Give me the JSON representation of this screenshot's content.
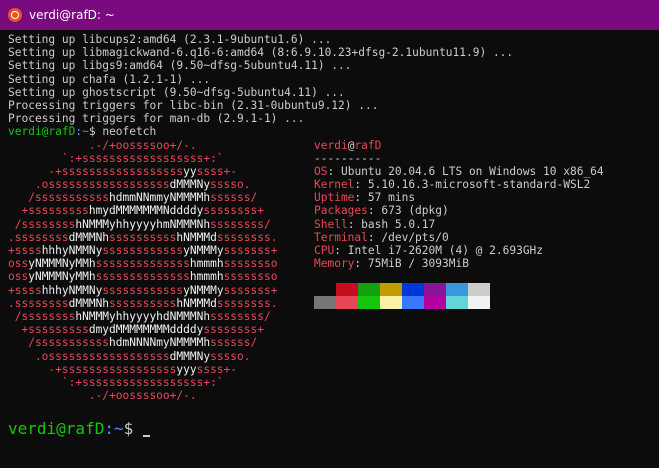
{
  "window": {
    "title": "verdi@rafD: ~",
    "icon": "ubuntu-icon"
  },
  "output_lines": [
    "Setting up libcups2:amd64 (2.3.1-9ubuntu1.6) ...",
    "Setting up libmagickwand-6.q16-6:amd64 (8:6.9.10.23+dfsg-2.1ubuntu11.9) ...",
    "Setting up libgs9:amd64 (9.50~dfsg-5ubuntu4.11) ...",
    "Setting up chafa (1.2.1-1) ...",
    "Setting up ghostscript (9.50~dfsg-5ubuntu4.11) ...",
    "Processing triggers for libc-bin (2.31-0ubuntu9.12) ...",
    "Processing triggers for man-db (2.9.1-1) ..."
  ],
  "prompt": {
    "user_host": "verdi@rafD",
    "path": ":~",
    "symbol": "$ ",
    "command": "neofetch"
  },
  "logo_lines": [
    "            .-/+oossssoo+/-.",
    "        `:+ssssssssssssssssss+:`",
    "      -+ssssssssssssssssssyyssss+-",
    "    .ossssssssssssssssssdMMMNysssso.",
    "   /ssssssssssshdmmNNmmyNMMMMhssssss/",
    "  +ssssssssshmydMMMMMMMNddddyssssssss+",
    " /sssssssshNMMMyhhyyyyhmNMMMNhssssssss/",
    ".ssssssssdMMMNhsssssssssshNMMMdssssssss.",
    "+sssshhhyNMMNyssssssssssssyNMMMysssssss+",
    "ossyNMMMNyMMhsssssssssssssshmmmhssssssso",
    "ossyNMMMNyMMhsssssssssssssshmmmhssssssso",
    "+sssshhhyNMMNyssssssssssssyNMMMysssssss+",
    ".ssssssssdMMMNhsssssssssshNMMMdssssssss.",
    " /sssssssshNMMMyhhyyyyhdNMMMNhssssssss/",
    "  +sssssssssdmydMMMMMMMMddddyssssssss+",
    "   /ssssssssssshdmNNNNmyNMMMMhssssss/",
    "    .ossssssssssssssssssdMMMNysssso.",
    "      -+sssssssssssssssssyyyssss+-",
    "        `:+ssssssssssssssssss+:`",
    "            .-/+oossssoo+/-."
  ],
  "info": {
    "user": "verdi",
    "at": "@",
    "host": "rafD",
    "separator": "----------",
    "rows": [
      {
        "key": "OS",
        "value": "Ubuntu 20.04.6 LTS on Windows 10 x86_64"
      },
      {
        "key": "Kernel",
        "value": "5.10.16.3-microsoft-standard-WSL2"
      },
      {
        "key": "Uptime",
        "value": "57 mins"
      },
      {
        "key": "Packages",
        "value": "673 (dpkg)"
      },
      {
        "key": "Shell",
        "value": "bash 5.0.17"
      },
      {
        "key": "Terminal",
        "value": "/dev/pts/0"
      },
      {
        "key": "CPU",
        "value": "Intel i7-2620M (4) @ 2.693GHz"
      },
      {
        "key": "Memory",
        "value": "75MiB / 3093MiB"
      }
    ]
  },
  "palette": {
    "row1": [
      "#0c0c0c",
      "#c50f1f",
      "#13a10e",
      "#c19c00",
      "#0037da",
      "#881798",
      "#3a96dd",
      "#cccccc"
    ],
    "row2": [
      "#767676",
      "#e74856",
      "#16c60c",
      "#f9f1a5",
      "#3b78ff",
      "#b4009e",
      "#61d6d6",
      "#f2f2f2"
    ]
  },
  "final_prompt": {
    "user_host": "verdi@rafD",
    "path": ":~",
    "symbol": "$ "
  },
  "colors": {
    "titlebar": "#7a0a7f",
    "background": "#0c0c0c",
    "prompt_user": "#16c60c",
    "prompt_path": "#5b8cff",
    "logo": "#e74856"
  }
}
